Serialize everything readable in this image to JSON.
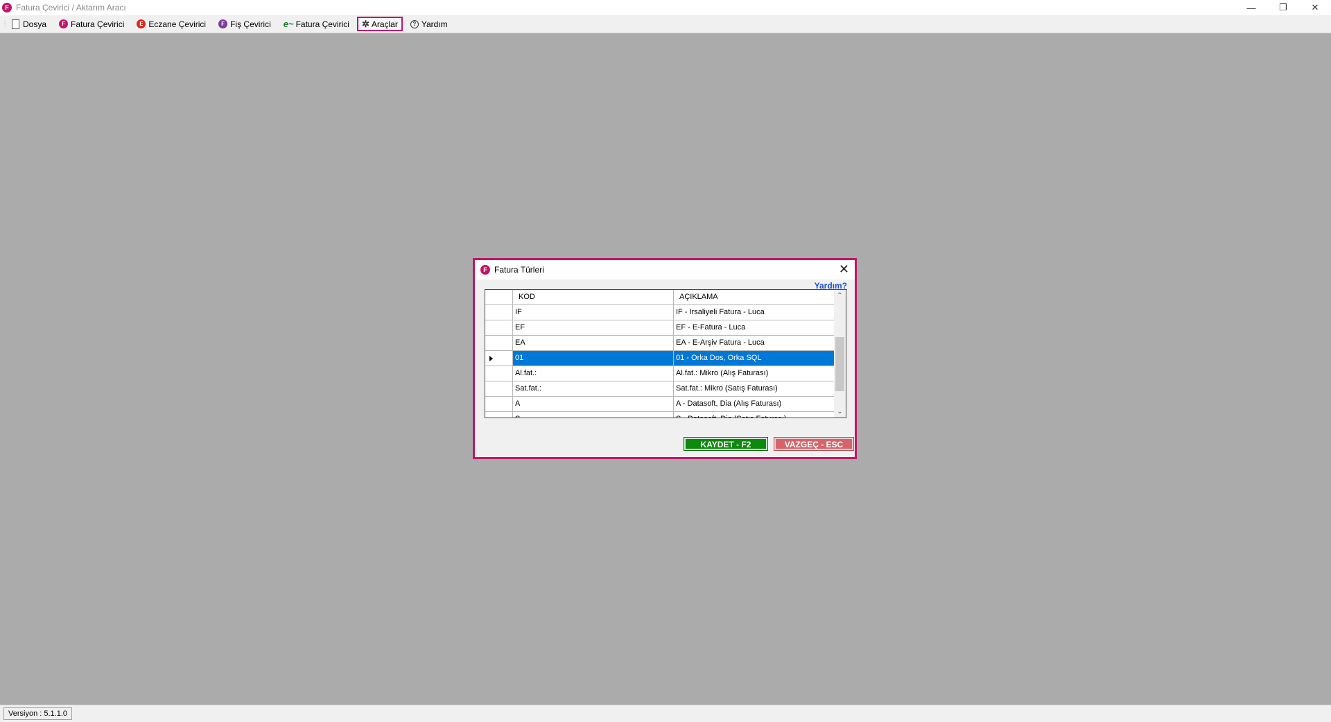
{
  "window": {
    "title": "Fatura Çevirici / Aktarım Aracı",
    "app_icon_letter": "F",
    "controls": {
      "minimize": "—",
      "restore": "❐",
      "close": "✕"
    }
  },
  "menu": {
    "items": [
      {
        "label": "Dosya",
        "icon": "document-icon"
      },
      {
        "label": "Fatura Çevirici",
        "icon": "F"
      },
      {
        "label": "Eczane Çevirici",
        "icon": "E"
      },
      {
        "label": "Fiş Çevirici",
        "icon": "F"
      },
      {
        "label": "Fatura Çevirici",
        "icon": "e-invoice-icon"
      },
      {
        "label": "Araçlar",
        "icon": "tools-icon",
        "active": true
      },
      {
        "label": "Yardım",
        "icon": "?"
      }
    ]
  },
  "status": {
    "version": "Versiyon : 5.1.1.0"
  },
  "dialog": {
    "title": "Fatura Türleri",
    "icon_letter": "F",
    "help_link": "Yardım?",
    "columns": {
      "code": "KOD",
      "description": "AÇIKLAMA"
    },
    "rows": [
      {
        "code": "IF",
        "description": "IF - Irsaliyeli Fatura - Luca"
      },
      {
        "code": "EF",
        "description": "EF - E-Fatura - Luca"
      },
      {
        "code": "EA",
        "description": "EA - E-Arşiv Fatura - Luca"
      },
      {
        "code": "01",
        "description": "01 - Orka Dos, Orka SQL",
        "selected": true
      },
      {
        "code": "Al.fat.:",
        "description": "Al.fat.: Mikro (Alış Faturası)"
      },
      {
        "code": "Sat.fat.:",
        "description": "Sat.fat.: Mikro (Satış Faturası)"
      },
      {
        "code": "A",
        "description": "A - Datasoft, Dia (Alış Faturası)"
      },
      {
        "code": "S",
        "description": "S - Datasoft, Dia (Satış Faturası)"
      }
    ],
    "buttons": {
      "save": "KAYDET - F2",
      "cancel": "VAZGEÇ - ESC"
    }
  }
}
